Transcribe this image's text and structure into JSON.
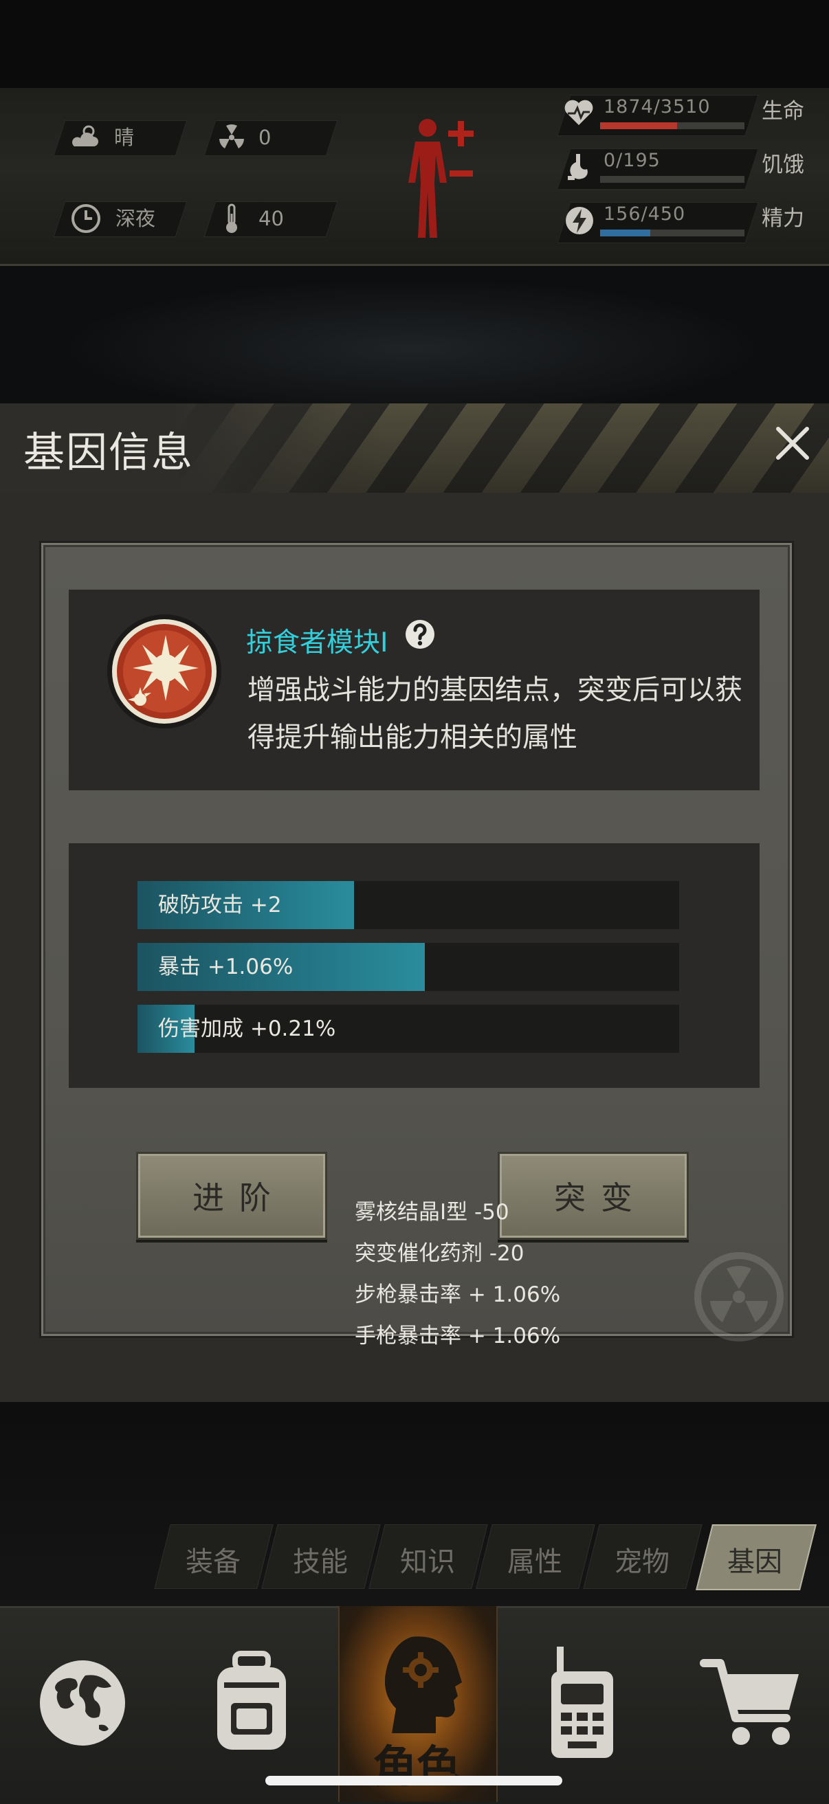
{
  "status": {
    "weather": "晴",
    "radiation": "0",
    "time_of_day": "深夜",
    "temperature": "40",
    "vitals": [
      {
        "value": "1874/3510",
        "label": "生命",
        "fraction": 0.534,
        "color": "#b8372d",
        "icon": "heart-pulse-icon"
      },
      {
        "value": "0/195",
        "label": "饥饿",
        "fraction": 0.0,
        "color": "#8a8a84",
        "icon": "stomach-icon"
      },
      {
        "value": "156/450",
        "label": "精力",
        "fraction": 0.347,
        "color": "#2f6e9e",
        "icon": "energy-bolt-icon"
      }
    ]
  },
  "dialog": {
    "title": "基因信息",
    "gene": {
      "name": "掠食者模块Ⅰ",
      "description": "增强战斗能力的基因结点，突变后可以获得提升输出能力相关的属性"
    },
    "stats": [
      {
        "label": "破防攻击 +2",
        "fraction": 0.4
      },
      {
        "label": "暴击 +1.06%",
        "fraction": 0.53
      },
      {
        "label": "伤害加成 +0.21%",
        "fraction": 0.105
      }
    ],
    "buttons": {
      "advance": "进阶",
      "mutate": "突变"
    },
    "costs": [
      "雾核结晶Ⅰ型 -50",
      "突变催化药剂 -20",
      "步枪暴击率 + 1.06%",
      "手枪暴击率 + 1.06%"
    ]
  },
  "tabs": [
    "装备",
    "技能",
    "知识",
    "属性",
    "宠物",
    "基因"
  ],
  "active_tab": "基因",
  "bottom_nav": {
    "active_label": "角色",
    "items": [
      "globe-icon",
      "backpack-icon",
      "character-head-icon",
      "radio-icon",
      "cart-icon"
    ]
  },
  "colors": {
    "accent_cyan": "#33d0dc",
    "stat_fill": "#237585",
    "health_red": "#b8372d",
    "energy_blue": "#2f6e9e"
  }
}
